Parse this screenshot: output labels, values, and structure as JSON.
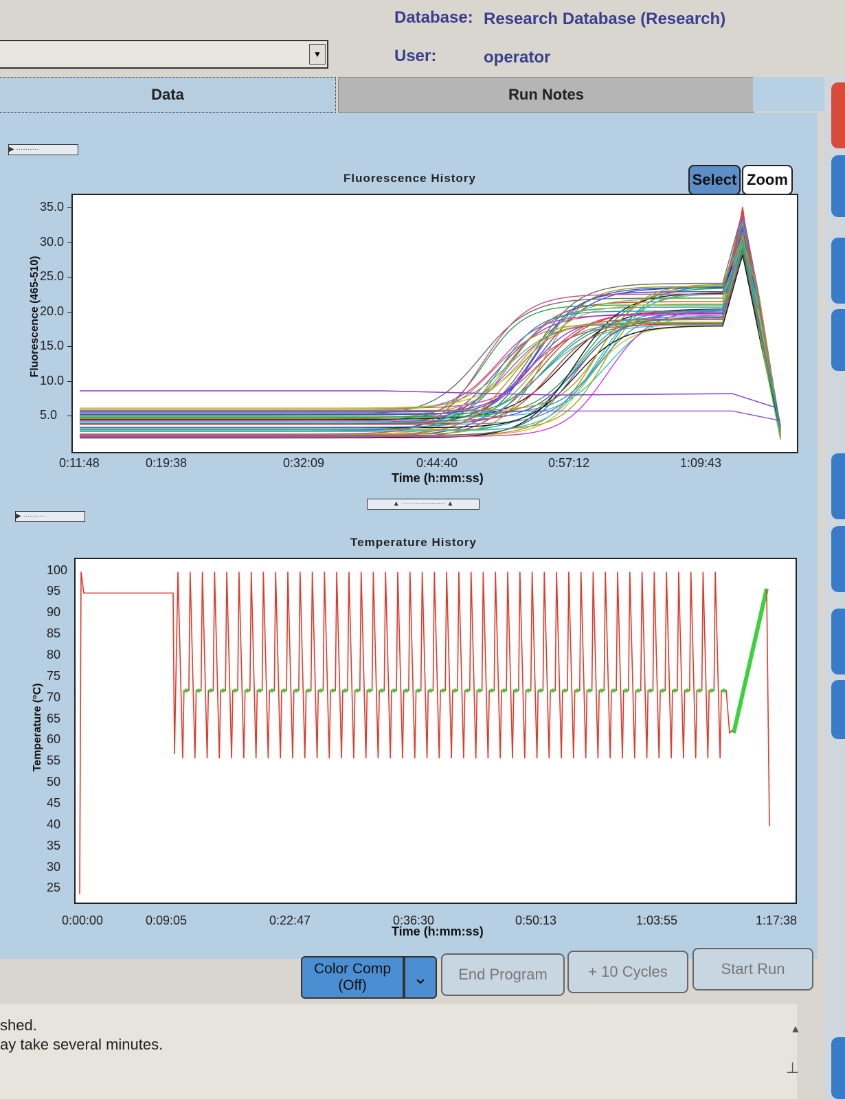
{
  "header": {
    "database_label": "Database:",
    "database_value": "Research Database (Research)",
    "user_label": "User:",
    "user_value": "operator"
  },
  "tabs": [
    {
      "label": "Data",
      "active": true
    },
    {
      "label": "Run Notes",
      "active": false
    }
  ],
  "chart_buttons": {
    "select": "Select",
    "zoom": "Zoom"
  },
  "bottom_buttons": {
    "color_comp_line1": "Color Comp",
    "color_comp_line2": "(Off)",
    "end_program": "End Program",
    "add_cycles": "+ 10 Cycles",
    "start_run": "Start Run"
  },
  "status": {
    "line1": "shed.",
    "line2": "ay take several minutes."
  },
  "chart_data": [
    {
      "type": "line",
      "title": "Fluorescence History",
      "xlabel": "Time (h:mm:ss)",
      "ylabel": "Fluorescence (465-510)",
      "x_ticks": [
        "0:11:48",
        "0:19:38",
        "0:32:09",
        "0:44:40",
        "0:57:12",
        "1:09:43"
      ],
      "y_ticks": [
        "35.0",
        "30.0",
        "25.0",
        "20.0",
        "15.0",
        "10.0",
        "5.0"
      ],
      "ylim": [
        0,
        37
      ],
      "grid": false,
      "note": "many overlapping sigmoid amplification curves (approx. 45 series), baseline 2-6, plateau 18-24, melt peak 28-35 near end",
      "series_summary": {
        "baseline_range": [
          2,
          6.5
        ],
        "plateau_range": [
          18,
          24.5
        ],
        "peak_range": [
          28,
          35.5
        ]
      }
    },
    {
      "type": "line",
      "title": "Temperature History",
      "xlabel": "Time (h:mm:ss)",
      "ylabel": "Temperature (°C)",
      "x_ticks": [
        "0:00:00",
        "0:09:05",
        "0:22:47",
        "0:36:30",
        "0:50:13",
        "1:03:55",
        "1:17:38"
      ],
      "y_ticks": [
        "100",
        "95",
        "90",
        "85",
        "80",
        "75",
        "70",
        "65",
        "60",
        "55",
        "50",
        "45",
        "40",
        "35",
        "30",
        "25"
      ],
      "ylim": [
        22,
        103
      ],
      "grid": false,
      "series": [
        {
          "name": "",
          "color": "#e03a2a",
          "pattern": "initial 95 hold then 45 cycles 95/55/72"
        },
        {
          "name": "",
          "color": "#3cd23c",
          "pattern": "acquisition markers at ~72 each cycle, melt ramp 62 to 96"
        }
      ],
      "cycles": 45
    }
  ],
  "colors": {
    "panel_bg": "#b7cfe3",
    "plot_bg": "#ffffff",
    "temp_line": "#e03a2a",
    "acquisition": "#3cd23c",
    "accent_blue": "#3a7bc8"
  }
}
